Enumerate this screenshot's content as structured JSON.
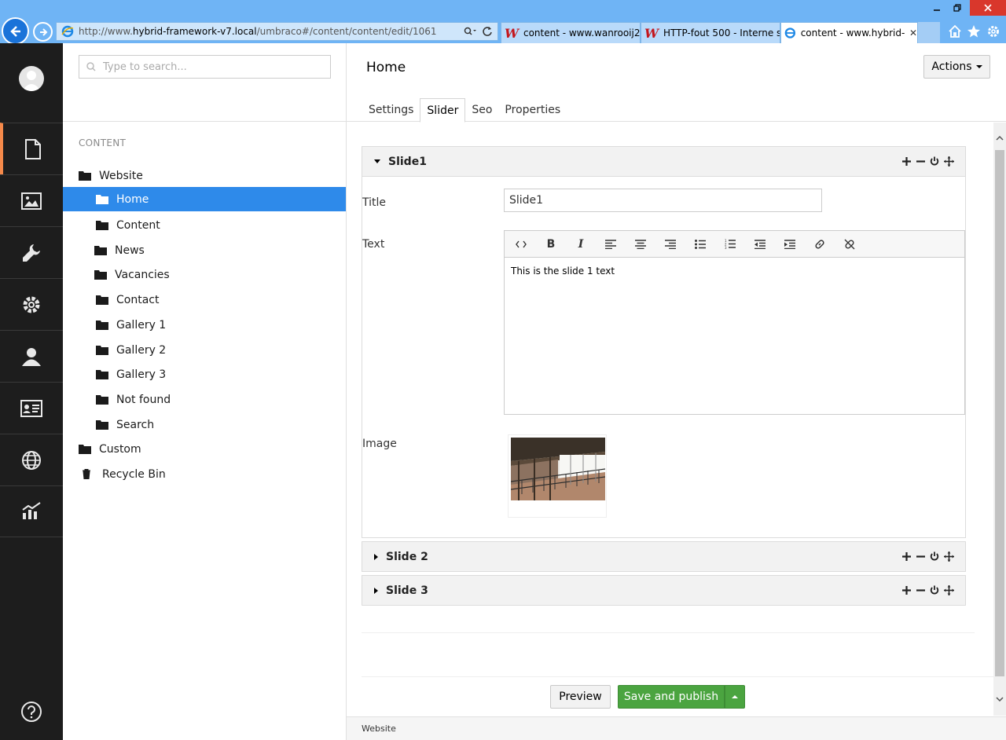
{
  "browser": {
    "url_prefix": "http://www.",
    "url_host": "hybrid-framework-v7.local",
    "url_path": "/umbraco#/content/content/edit/1061",
    "tabs": [
      {
        "label": "content - www.wanrooij20..."
      },
      {
        "label": "HTTP-fout 500 - Interne se..."
      },
      {
        "label": "content - www.hybrid-..."
      }
    ]
  },
  "search": {
    "placeholder": "Type to search..."
  },
  "tree": {
    "title": "CONTENT",
    "items": [
      {
        "label": "Website"
      },
      {
        "label": "Home"
      },
      {
        "label": "Content"
      },
      {
        "label": "News"
      },
      {
        "label": "Vacancies"
      },
      {
        "label": "Contact"
      },
      {
        "label": "Gallery 1"
      },
      {
        "label": "Gallery 2"
      },
      {
        "label": "Gallery 3"
      },
      {
        "label": "Not found"
      },
      {
        "label": "Search"
      },
      {
        "label": "Custom"
      },
      {
        "label": "Recycle Bin"
      }
    ]
  },
  "header": {
    "title": "Home",
    "actions_label": "Actions",
    "tabs": [
      {
        "label": "Settings"
      },
      {
        "label": "Slider"
      },
      {
        "label": "Seo"
      },
      {
        "label": "Properties"
      }
    ]
  },
  "slides": [
    {
      "name": "Slide1"
    },
    {
      "name": "Slide 2"
    },
    {
      "name": "Slide 3"
    }
  ],
  "slide1": {
    "title_label": "Title",
    "title_value": "Slide1",
    "text_label": "Text",
    "text_value": "This is the slide 1 text",
    "image_label": "Image"
  },
  "footer": {
    "preview_label": "Preview",
    "publish_label": "Save and publish",
    "breadcrumb": "Website"
  },
  "colors": {
    "selected": "#2e8aea",
    "publish": "#4ba440",
    "active_section": "#f5894a",
    "appbar": "#1d1d1d"
  }
}
